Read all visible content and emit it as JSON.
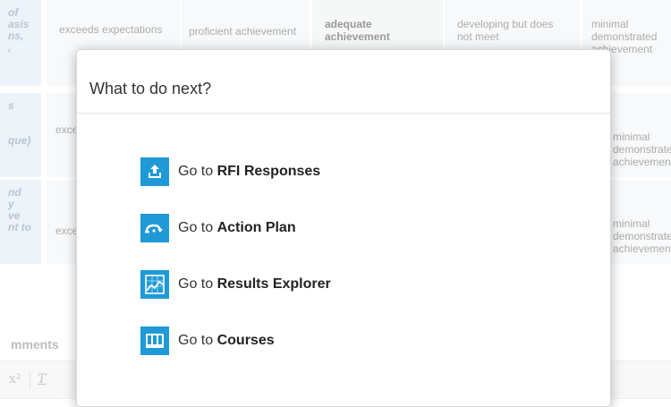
{
  "rubric": {
    "rows": [
      {
        "head": "of\nasis\nns,\n,",
        "cells": [
          "exceeds expectations",
          "proficient achievement",
          "adequate achievement",
          "developing but does not meet",
          "minimal demonstrated achievement"
        ]
      },
      {
        "head": "s\n\n\nque)",
        "cells": [
          "exceeds expectations",
          "",
          "",
          "",
          "minimal demonstrated achievement"
        ]
      },
      {
        "head": "nd\ny\nve\nnt to",
        "cells": [
          "exceeds expectations",
          "",
          "",
          "",
          "minimal demonstrated achievement"
        ]
      }
    ],
    "comments_label": "mments"
  },
  "editor": {
    "superscript": "x²",
    "clear_format": "T"
  },
  "modal": {
    "title": "What to do next?",
    "options": [
      {
        "prefix": "Go to",
        "target": "RFI Responses",
        "icon": "upload-icon"
      },
      {
        "prefix": "Go to",
        "target": "Action Plan",
        "icon": "action-plan-arrow-icon"
      },
      {
        "prefix": "Go to",
        "target": "Results Explorer",
        "icon": "chart-icon"
      },
      {
        "prefix": "Go to",
        "target": "Courses",
        "icon": "columns-icon"
      }
    ]
  },
  "colors": {
    "icon_bg": "#1f9ad6",
    "rowhead_bg": "#dde9f4",
    "cell_bg": "#f1f4f7"
  }
}
